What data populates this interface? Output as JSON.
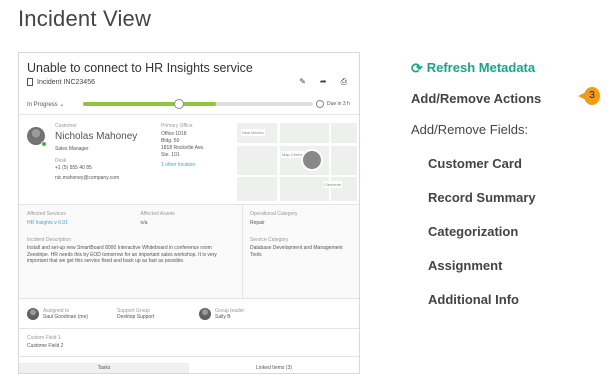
{
  "page": {
    "title": "Incident View"
  },
  "incident": {
    "title": "Unable to connect to HR Insights service",
    "id": "Incident INC23456",
    "status": "In Progress",
    "progress_fraction": 0.58,
    "due_label": "Due in 3 h",
    "customer": {
      "label": "Customer",
      "name": "Nicholas Mahoney",
      "role": "Sales Manager",
      "phone_label": "Desk",
      "phone": "+1 (5) 555 40 85",
      "email": "nic.mahoney@company.com"
    },
    "office": {
      "label": "Primary Office",
      "lines": [
        "Office 1018",
        "Bldg. 50",
        "1818 Rockville Ave.",
        "Ste. 101"
      ],
      "link": "1 other location"
    },
    "map": {
      "labels": [
        "New Mexico",
        "Map Centre",
        "Clemente"
      ]
    },
    "affected_service": {
      "label": "Affected Services",
      "value": "HR Insights v 6.01"
    },
    "affected_assets": {
      "label": "Affected Assets",
      "value": "n/a"
    },
    "description": {
      "label": "Incident Description",
      "text": "Install and set-up new SmartBoard 8000 Interactive Whiteboard in conference room Zeestripe. HR needs this by EOD tomorrow for an important sales workshop. It is very important that we get this service fixed and back up as fast as possible."
    },
    "operational_category": {
      "label": "Operational Category",
      "value": "Repair"
    },
    "service_category": {
      "label": "Service Category",
      "value": "Database Development and Management Tools"
    },
    "assigned_to": {
      "label": "Assigned to",
      "value": "Saul Goodman (me)"
    },
    "support_group": {
      "label": "Support Group",
      "value": "Desktop Support"
    },
    "group_lead": {
      "label": "Group leader",
      "value": "Sally B"
    },
    "custom_field": {
      "label": "Custom Field 1",
      "value": "Custome Field 2"
    },
    "tabs": [
      "Tasks",
      "Linked Items (3)"
    ]
  },
  "panel": {
    "refresh_label": "Refresh Metadata",
    "add_remove_actions": "Add/Remove Actions",
    "badge": "3",
    "add_remove_fields": "Add/Remove Fields:",
    "fields": [
      "Customer Card",
      "Record Summary",
      "Categorization",
      "Assignment",
      "Additional Info"
    ],
    "accent_color": "#17a589",
    "badge_color": "#f39c12"
  }
}
